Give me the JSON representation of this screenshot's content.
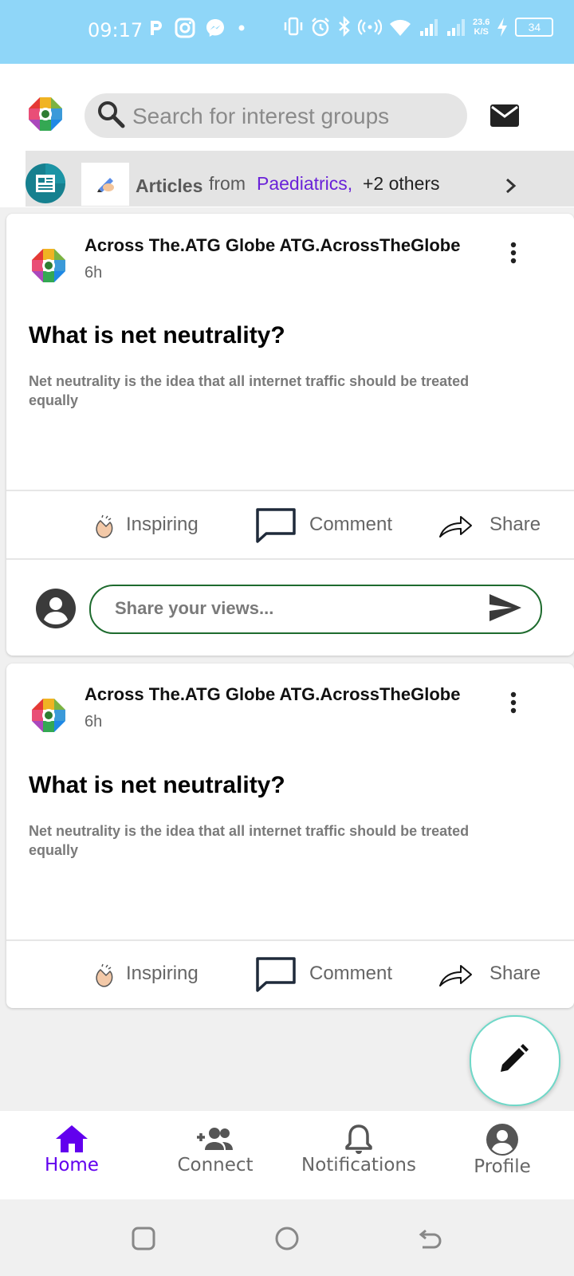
{
  "status_bar": {
    "time": "09:17",
    "speed_value": "23.6",
    "speed_unit": "K/S",
    "battery": "34"
  },
  "header": {
    "search_placeholder": "Search for interest groups"
  },
  "articles_bar": {
    "label": "Articles",
    "from": "from",
    "group": "Paediatrics,",
    "others": "+2 others"
  },
  "posts": [
    {
      "author": "Across The.ATG Globe ATG.AcrossTheGlobe",
      "time": "6h",
      "title": "What is net neutrality?",
      "description": "Net neutrality is the idea that all internet traffic should be treated equally",
      "actions": {
        "inspiring": "Inspiring",
        "comment": "Comment",
        "share": "Share"
      },
      "comment_placeholder": "Share your views..."
    },
    {
      "author": "Across The.ATG Globe ATG.AcrossTheGlobe",
      "time": "6h",
      "title": "What is net neutrality?",
      "description": "Net neutrality is the idea that all internet traffic should be treated equally",
      "actions": {
        "inspiring": "Inspiring",
        "comment": "Comment",
        "share": "Share"
      }
    }
  ],
  "bottom_nav": {
    "home": "Home",
    "connect": "Connect",
    "notifications": "Notifications",
    "profile": "Profile"
  },
  "colors": {
    "accent": "#6200ee",
    "status_bar": "#8fd6f8",
    "group_link": "#6a22d8",
    "comment_border": "#1e6b2e",
    "fab_border": "#6fd8c8"
  }
}
